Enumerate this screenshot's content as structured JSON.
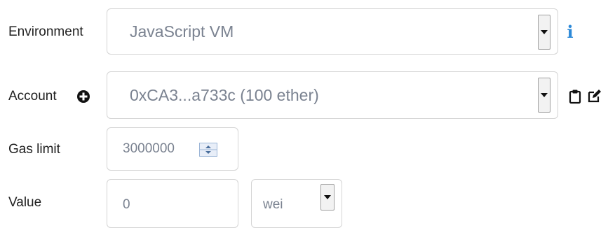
{
  "environment": {
    "label": "Environment",
    "value": "JavaScript VM",
    "info_icon": "info-icon"
  },
  "account": {
    "label": "Account",
    "value": "0xCA3...a733c (100 ether)",
    "add_icon": "plus-circle-icon",
    "copy_icon": "clipboard-icon",
    "edit_icon": "edit-icon"
  },
  "gas": {
    "label": "Gas limit",
    "value": "3000000"
  },
  "value": {
    "label": "Value",
    "amount": "0",
    "unit": "wei"
  },
  "colors": {
    "accent": "#2c89d8",
    "text_muted": "#7a8290"
  }
}
